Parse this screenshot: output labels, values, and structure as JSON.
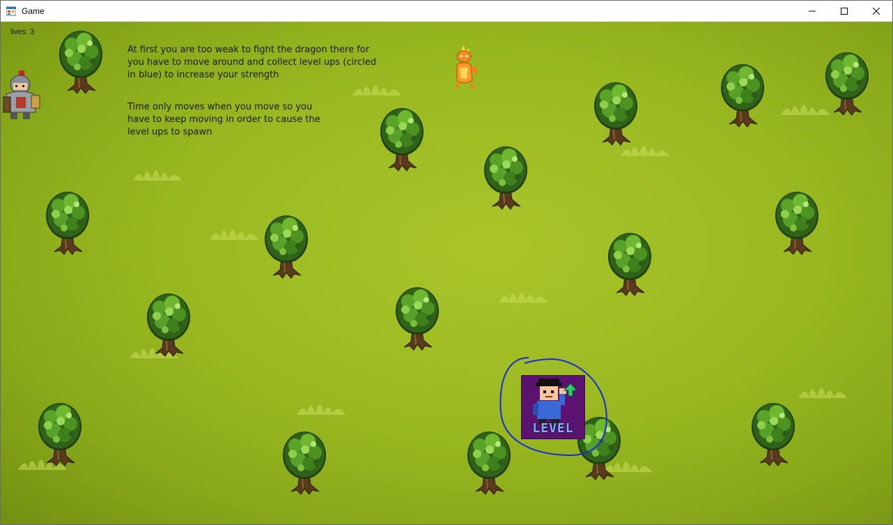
{
  "window": {
    "title": "Game",
    "controls": [
      "minimize",
      "maximize",
      "close"
    ]
  },
  "hud": {
    "lives_label": "lives: 3"
  },
  "instructions": {
    "paragraph_1": "At first you are too weak to fight the dragon there for\nyou have to move around and collect level ups (circled\nin blue) to increase your strength",
    "paragraph_2": "Time only moves when you move so you\nhave to keep moving in order to cause the\nlevel ups to spawn"
  },
  "level_up": {
    "label": "LEVEL",
    "icon": "green-up-arrow-icon"
  },
  "entities": {
    "player": "knight-player-icon",
    "dragon": "orange-dragon-icon",
    "tree_count": 18
  },
  "colors": {
    "grass": "#9ab921",
    "annotation_circle": "#1a2bd6",
    "levelup_bg": "#5a1470"
  }
}
